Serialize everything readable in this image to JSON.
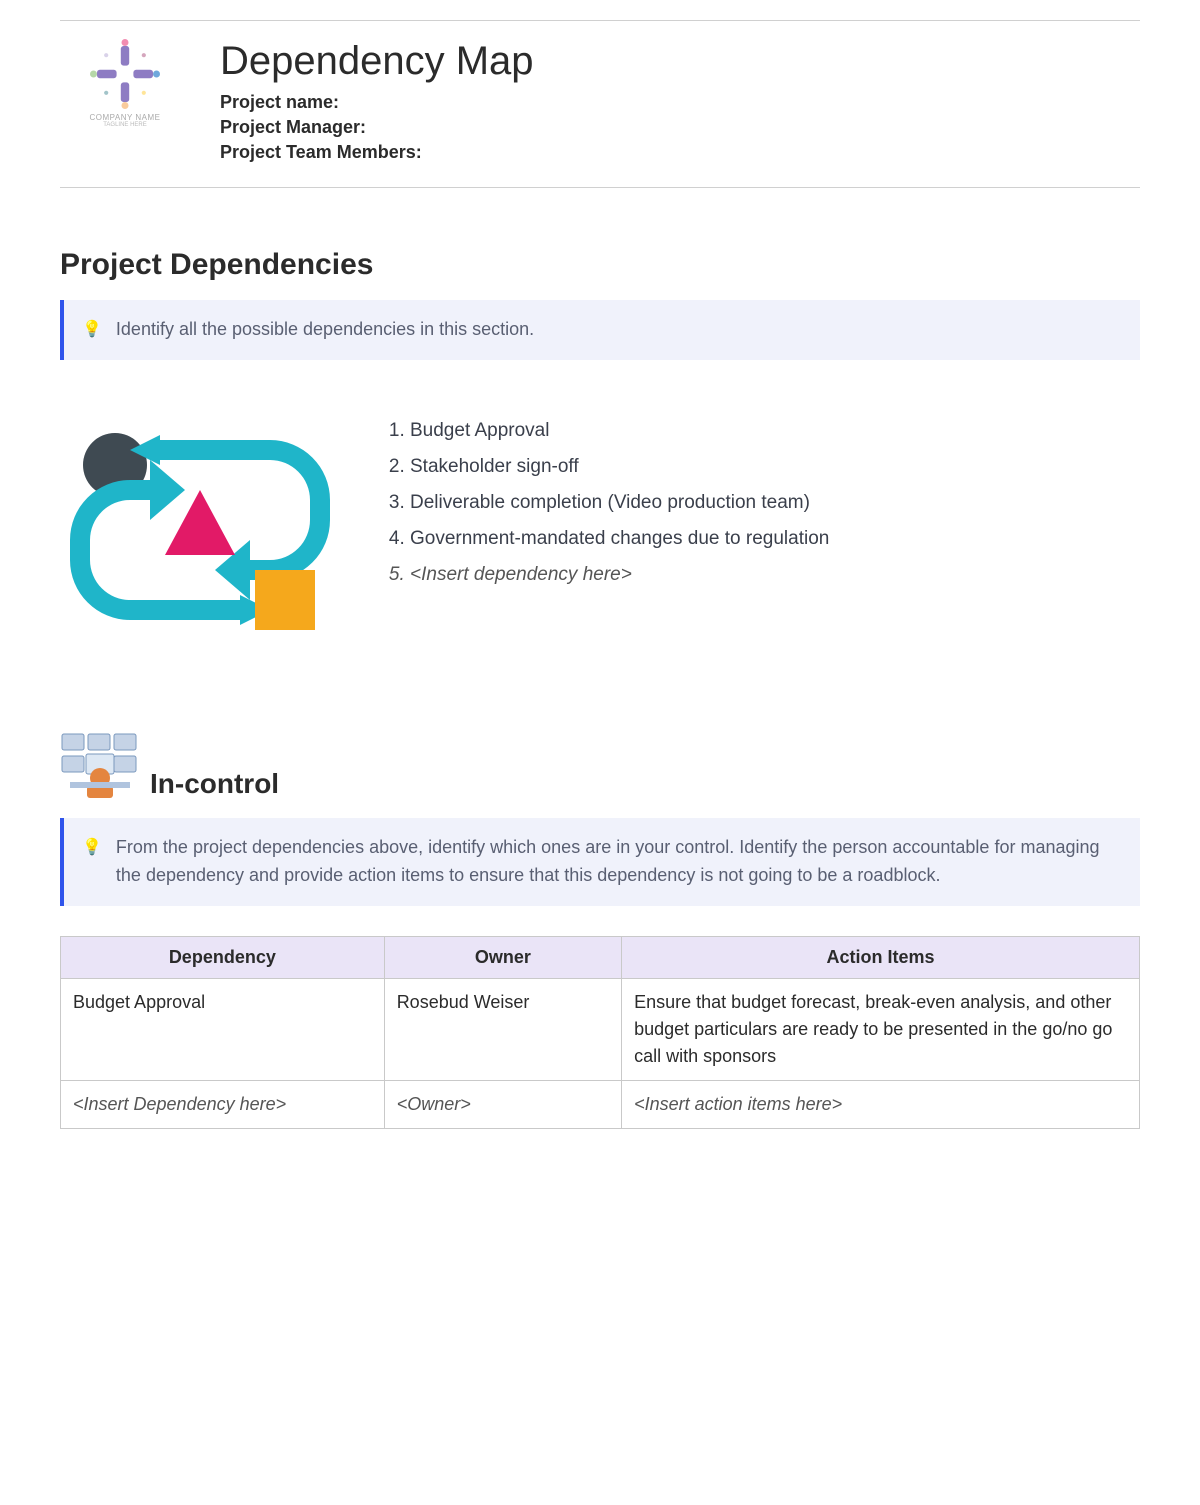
{
  "header": {
    "title": "Dependency Map",
    "logo_caption1": "COMPANY NAME",
    "logo_caption2": "TAGLINE HERE",
    "meta": [
      "Project name:",
      "Project Manager:",
      "Project Team Members:"
    ]
  },
  "section1": {
    "title": "Project Dependencies",
    "callout": "Identify all the possible dependencies in this section.",
    "items": [
      "Budget Approval",
      "Stakeholder sign-off",
      "Deliverable completion (Video production team)",
      "Government-mandated changes due to regulation",
      "<Insert dependency here>"
    ]
  },
  "section2": {
    "title": "In-control",
    "callout": "From the project dependencies above, identify which ones are in your control. Identify the person accountable for managing the dependency and provide action items to ensure that this dependency is not going to be a roadblock.",
    "table": {
      "headers": [
        "Dependency",
        "Owner",
        "Action Items"
      ],
      "rows": [
        {
          "dependency": "Budget Approval",
          "owner": "Rosebud Weiser",
          "action": "Ensure that budget forecast, break-even analysis, and other budget particulars are ready to be presented in the go/no go call with sponsors",
          "italic": false
        },
        {
          "dependency": "<Insert Dependency here>",
          "owner": "<Owner>",
          "action": "<Insert action items here>",
          "italic": true
        }
      ]
    }
  }
}
